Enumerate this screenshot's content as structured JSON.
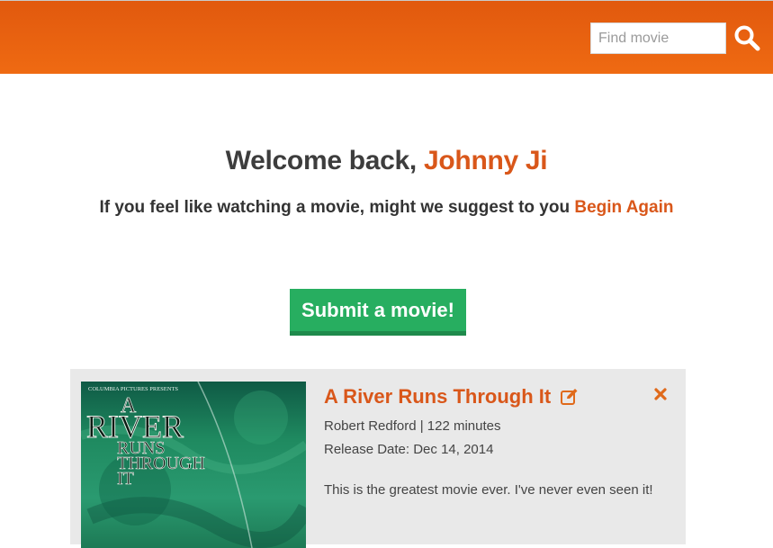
{
  "header": {
    "search": {
      "placeholder": "Find movie",
      "value": ""
    },
    "search_icon": "search-icon",
    "colors": {
      "header_start": "#e1590e",
      "header_end": "#ef6a12"
    }
  },
  "main": {
    "welcome_prefix": "Welcome back, ",
    "user_name": "Johnny Ji",
    "suggestion_prefix": "If you feel like watching a movie, might we suggest to you ",
    "suggested_movie": "Begin Again",
    "submit_label": "Submit a movie!"
  },
  "movie": {
    "title": "A River Runs Through It",
    "director_runtime": "Robert Redford | 122 minutes",
    "release": "Release Date: Dec 14, 2014",
    "description": "This is the greatest movie ever. I've never even seen it!",
    "poster": {
      "studio": "COLUMBIA PICTURES PRESENTS",
      "line_a": "A",
      "line_river": "RIVER",
      "line_runs": "RUNS",
      "line_through": "THROUGH",
      "line_it": "IT"
    },
    "edit_icon": "edit-icon",
    "delete_icon": "close-icon"
  },
  "colors": {
    "accent": "#d9571a",
    "button_green": "#27ae60",
    "card_bg": "#e9e9e9"
  }
}
